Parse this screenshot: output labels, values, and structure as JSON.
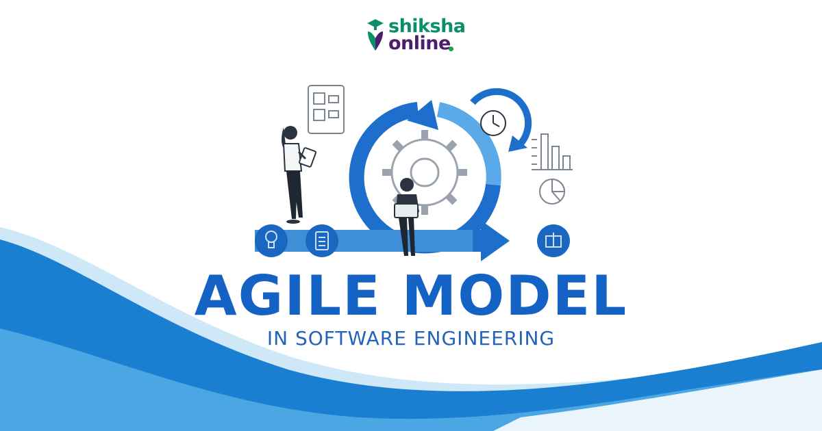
{
  "brand": {
    "line1": "shiksha",
    "line2": "online",
    "color_primary": "#0a8f6a",
    "color_secondary": "#4b1d6e"
  },
  "hero": {
    "title": "AGILE MODEL",
    "subtitle": "IN SOFTWARE ENGINEERING"
  },
  "colors": {
    "accent_blue": "#1463c4",
    "wave_dark": "#1a7fd0",
    "wave_light": "#4aa7e3"
  },
  "icons": [
    "lightbulb-icon",
    "clipboard-icon",
    "gift-box-icon",
    "gear-icon",
    "clock-icon",
    "bar-chart-icon",
    "pie-chart-icon",
    "document-icon"
  ]
}
